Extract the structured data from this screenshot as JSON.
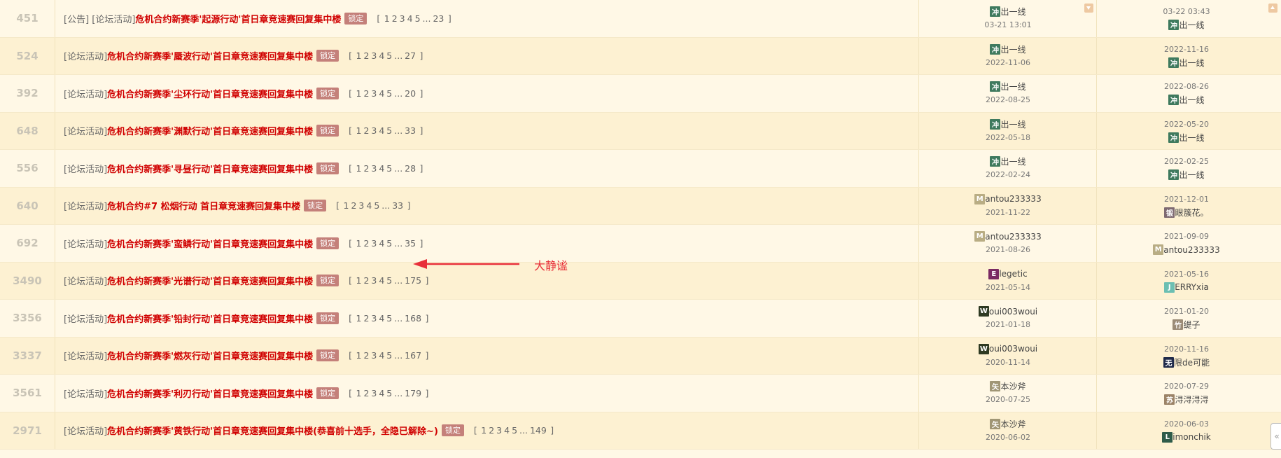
{
  "colors": {
    "title_red": "#d00000",
    "lock_badge": "#c4807a",
    "annotation": "#e8303a",
    "row_odd": "#fff8e6",
    "row_even": "#fdf1d2"
  },
  "rows": [
    {
      "replies": "451",
      "prefix": "[公告] [论坛活动]",
      "title": "危机合约新赛季'起源行动'首日章竞速赛回复集中楼",
      "lock": "锁定",
      "pages": [
        "1",
        "2",
        "3",
        "4",
        "5"
      ],
      "ellipsis": "...",
      "last_page": "23",
      "author": {
        "avatar_char": "冲",
        "avatar_color": "#3f7a5e",
        "name": "出一线",
        "date": "03-21 13:01"
      },
      "last_post": {
        "date": "03-22 03:43",
        "avatar_char": "冲",
        "avatar_color": "#3f7a5e",
        "name": "出一线"
      }
    },
    {
      "replies": "524",
      "prefix": "[论坛活动]",
      "title": "危机合约新赛季'蜃波行动'首日章竞速赛回复集中楼",
      "lock": "锁定",
      "pages": [
        "1",
        "2",
        "3",
        "4",
        "5"
      ],
      "ellipsis": "...",
      "last_page": "27",
      "author": {
        "avatar_char": "冲",
        "avatar_color": "#3f7a5e",
        "name": "出一线",
        "date": "2022-11-06"
      },
      "last_post": {
        "date": "2022-11-16",
        "avatar_char": "冲",
        "avatar_color": "#3f7a5e",
        "name": "出一线"
      }
    },
    {
      "replies": "392",
      "prefix": "[论坛活动]",
      "title": "危机合约新赛季'尘环行动'首日章竞速赛回复集中楼",
      "lock": "锁定",
      "pages": [
        "1",
        "2",
        "3",
        "4",
        "5"
      ],
      "ellipsis": "...",
      "last_page": "20",
      "author": {
        "avatar_char": "冲",
        "avatar_color": "#3f7a5e",
        "name": "出一线",
        "date": "2022-08-25"
      },
      "last_post": {
        "date": "2022-08-26",
        "avatar_char": "冲",
        "avatar_color": "#3f7a5e",
        "name": "出一线"
      }
    },
    {
      "replies": "648",
      "prefix": "[论坛活动]",
      "title": "危机合约新赛季'渊默行动'首日章竞速赛回复集中楼",
      "lock": "锁定",
      "pages": [
        "1",
        "2",
        "3",
        "4",
        "5"
      ],
      "ellipsis": "...",
      "last_page": "33",
      "author": {
        "avatar_char": "冲",
        "avatar_color": "#3f7a5e",
        "name": "出一线",
        "date": "2022-05-18"
      },
      "last_post": {
        "date": "2022-05-20",
        "avatar_char": "冲",
        "avatar_color": "#3f7a5e",
        "name": "出一线"
      }
    },
    {
      "replies": "556",
      "prefix": "[论坛活动]",
      "title": "危机合约新赛季'寻昼行动'首日章竞速赛回复集中楼",
      "lock": "锁定",
      "pages": [
        "1",
        "2",
        "3",
        "4",
        "5"
      ],
      "ellipsis": "...",
      "last_page": "28",
      "author": {
        "avatar_char": "冲",
        "avatar_color": "#3f7a5e",
        "name": "出一线",
        "date": "2022-02-24"
      },
      "last_post": {
        "date": "2022-02-25",
        "avatar_char": "冲",
        "avatar_color": "#3f7a5e",
        "name": "出一线"
      }
    },
    {
      "replies": "640",
      "prefix": "[论坛活动]",
      "title": "危机合约#7 松烟行动 首日章竞速赛回复集中楼",
      "lock": "锁定",
      "pages": [
        "1",
        "2",
        "3",
        "4",
        "5"
      ],
      "ellipsis": "...",
      "last_page": "33",
      "author": {
        "avatar_char": "M",
        "avatar_color": "#b9ad84",
        "name": "antou233333",
        "date": "2021-11-22"
      },
      "last_post": {
        "date": "2021-12-01",
        "avatar_char": "锻",
        "avatar_color": "#7e6a72",
        "name": "眼簇花。"
      }
    },
    {
      "replies": "692",
      "prefix": "[论坛活动]",
      "title": "危机合约新赛季'蛮鳞行动'首日章竞速赛回复集中楼",
      "lock": "锁定",
      "pages": [
        "1",
        "2",
        "3",
        "4",
        "5"
      ],
      "ellipsis": "...",
      "last_page": "35",
      "author": {
        "avatar_char": "M",
        "avatar_color": "#b9ad84",
        "name": "antou233333",
        "date": "2021-08-26"
      },
      "last_post": {
        "date": "2021-09-09",
        "avatar_char": "M",
        "avatar_color": "#b9ad84",
        "name": "antou233333"
      }
    },
    {
      "replies": "3490",
      "prefix": "[论坛活动]",
      "title": "危机合约新赛季'光谱行动'首日章竞速赛回复集中楼",
      "lock": "锁定",
      "pages": [
        "1",
        "2",
        "3",
        "4",
        "5"
      ],
      "ellipsis": "...",
      "last_page": "175",
      "author": {
        "avatar_char": "E",
        "avatar_color": "#7a2a63",
        "name": "legetic",
        "date": "2021-05-14"
      },
      "last_post": {
        "date": "2021-05-16",
        "avatar_char": "J",
        "avatar_color": "#6cbfb2",
        "name": "ERRYxia"
      }
    },
    {
      "replies": "3356",
      "prefix": "[论坛活动]",
      "title": "危机合约新赛季'铅封行动'首日章竞速赛回复集中楼",
      "lock": "锁定",
      "pages": [
        "1",
        "2",
        "3",
        "4",
        "5"
      ],
      "ellipsis": "...",
      "last_page": "168",
      "author": {
        "avatar_char": "W",
        "avatar_color": "#2e3a22",
        "name": "oui003woui",
        "date": "2021-01-18"
      },
      "last_post": {
        "date": "2021-01-20",
        "avatar_char": "竹",
        "avatar_color": "#9b8b76",
        "name": "缇子"
      }
    },
    {
      "replies": "3337",
      "prefix": "[论坛活动]",
      "title": "危机合约新赛季'燃灰行动'首日章竞速赛回复集中楼",
      "lock": "锁定",
      "pages": [
        "1",
        "2",
        "3",
        "4",
        "5"
      ],
      "ellipsis": "...",
      "last_page": "167",
      "author": {
        "avatar_char": "W",
        "avatar_color": "#2e3a22",
        "name": "oui003woui",
        "date": "2020-11-14"
      },
      "last_post": {
        "date": "2020-11-16",
        "avatar_char": "无",
        "avatar_color": "#1f2a4a",
        "name": "限de可能"
      }
    },
    {
      "replies": "3561",
      "prefix": "[论坛活动]",
      "title": "危机合约新赛季'利刃行动'首日章竞速赛回复集中楼",
      "lock": "锁定",
      "pages": [
        "1",
        "2",
        "3",
        "4",
        "5"
      ],
      "ellipsis": "...",
      "last_page": "179",
      "author": {
        "avatar_char": "矢",
        "avatar_color": "#a09675",
        "name": "本沙斧",
        "date": "2020-07-25"
      },
      "last_post": {
        "date": "2020-07-29",
        "avatar_char": "苏",
        "avatar_color": "#9c8468",
        "name": "浔浔浔浔"
      }
    },
    {
      "replies": "2971",
      "prefix": "[论坛活动]",
      "title": "危机合约新赛季'黄铁行动'首日章竞速赛回复集中楼(恭喜前十选手，全隐已解除~)",
      "lock": "锁定",
      "pages": [
        "1",
        "2",
        "3",
        "4",
        "5"
      ],
      "ellipsis": "...",
      "last_page": "149",
      "author": {
        "avatar_char": "矢",
        "avatar_color": "#a09675",
        "name": "本沙斧",
        "date": "2020-06-02"
      },
      "last_post": {
        "date": "2020-06-03",
        "avatar_char": "L",
        "avatar_color": "#2f5c4a",
        "name": "imonchik"
      }
    }
  ],
  "annotation": {
    "text": "大静谧",
    "arrow_color": "#e8303a"
  },
  "controls": {
    "collapse_glyph": "«",
    "dropdown_icon": "dropdown-arrow-icon",
    "scroll_icon": "scroll-up-icon"
  }
}
